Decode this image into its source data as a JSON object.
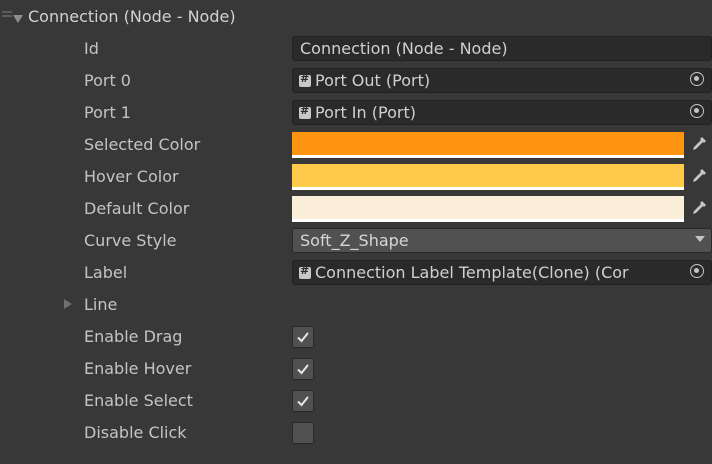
{
  "component": {
    "title": "Connection (Node - Node)"
  },
  "fields": {
    "id": {
      "label": "Id",
      "value": "Connection (Node - Node)"
    },
    "port0": {
      "label": "Port 0",
      "value": "Port Out (Port)",
      "icon": "script-icon"
    },
    "port1": {
      "label": "Port 1",
      "value": "Port In (Port)",
      "icon": "script-icon"
    },
    "selected_color": {
      "label": "Selected Color",
      "color": "#ff9411"
    },
    "hover_color": {
      "label": "Hover Color",
      "color": "#ffc94a"
    },
    "default_color": {
      "label": "Default Color",
      "color": "#fbeed9"
    },
    "curve_style": {
      "label": "Curve Style",
      "value": "Soft_Z_Shape"
    },
    "label": {
      "label": "Label",
      "value": "Connection Label Template(Clone) (Cor",
      "icon": "script-icon"
    },
    "line": {
      "label": "Line",
      "expanded": false
    },
    "enable_drag": {
      "label": "Enable Drag",
      "checked": true
    },
    "enable_hover": {
      "label": "Enable Hover",
      "checked": true
    },
    "enable_select": {
      "label": "Enable Select",
      "checked": true
    },
    "disable_click": {
      "label": "Disable Click",
      "checked": false
    }
  },
  "colors": {
    "background": "#383838",
    "field_bg": "#2a2a2a",
    "text": "#c4c4c4"
  }
}
